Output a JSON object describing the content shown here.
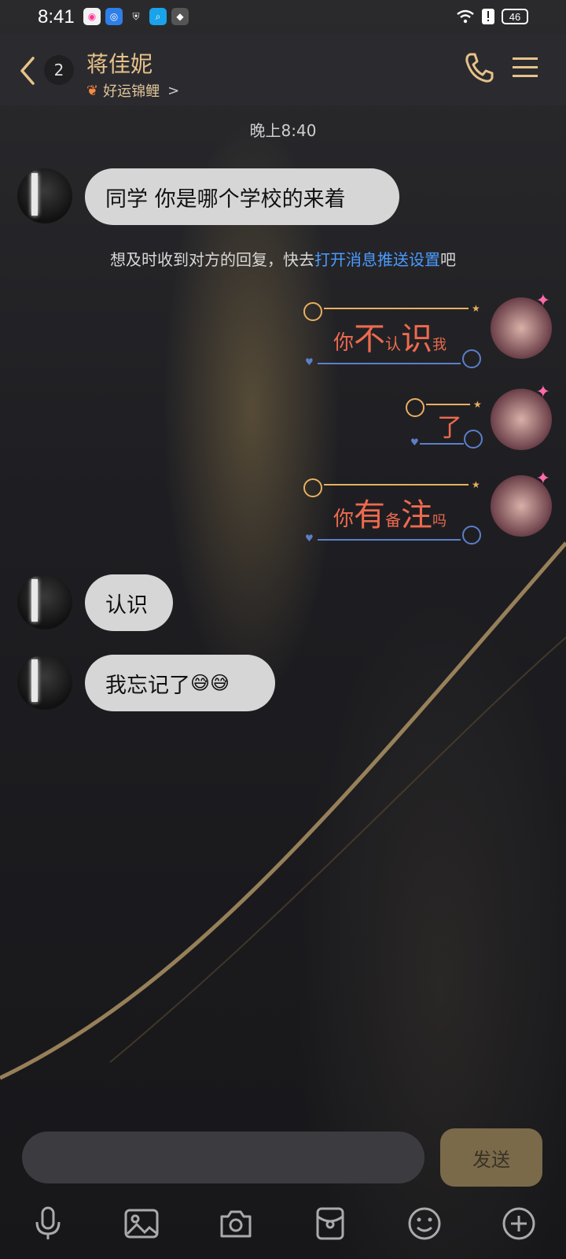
{
  "status": {
    "time": "8:41",
    "battery": "46"
  },
  "header": {
    "unread_count": "2",
    "contact_name": "蒋佳妮",
    "subtitle": "好运锦鲤",
    "subtitle_arrow": ">"
  },
  "chat": {
    "timestamp": "晚上8:40",
    "notice_before": "想及时收到对方的回复，快去",
    "notice_link": "打开消息推送设置",
    "notice_after": "吧",
    "messages": [
      {
        "side": "left",
        "text": "同学 你是哪个学校的来着"
      },
      {
        "side": "right",
        "parts": [
          "你",
          "不",
          "认",
          "识",
          "我"
        ]
      },
      {
        "side": "right",
        "parts": [
          "了"
        ]
      },
      {
        "side": "right",
        "parts": [
          "你",
          "有",
          "备",
          "注",
          "吗"
        ]
      },
      {
        "side": "left",
        "text": "认识"
      },
      {
        "side": "left",
        "text": "我忘记了"
      }
    ],
    "emoji": "😅😅"
  },
  "composer": {
    "send_label": "发送"
  },
  "toolbar": {
    "icons": [
      "microphone-icon",
      "image-icon",
      "camera-icon",
      "red-packet-icon",
      "emoji-icon",
      "plus-icon"
    ]
  },
  "colors": {
    "accent_gold": "#e7c28a",
    "link_blue": "#4b9bff",
    "bubble_grey": "#d6d6d6",
    "sticker_red": "#ee6a4e"
  }
}
